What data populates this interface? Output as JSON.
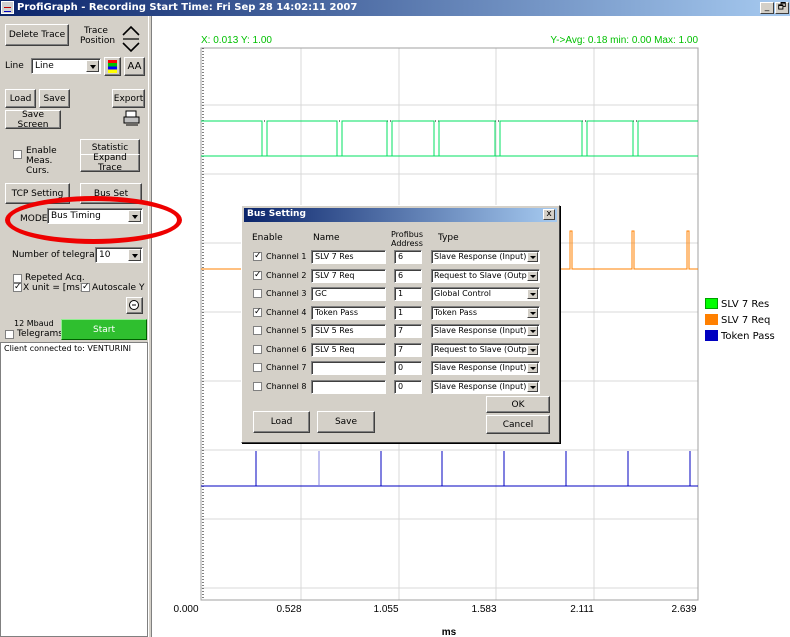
{
  "window": {
    "title": "ProfiGraph - Recording Start Time: Fri Sep 28 14:02:11 2007",
    "min_glyph": "_",
    "max_glyph": "🗗"
  },
  "left": {
    "delete_trace": "Delete Trace",
    "trace_position": "Trace Position",
    "line_label": "Line",
    "line_value": "Line",
    "font_glyph": "AA",
    "load": "Load",
    "save": "Save",
    "export": "Export",
    "save_screen": "Save Screen",
    "enable_meas": "Enable Meas. Curs.",
    "statistic": "Statistic",
    "expand_trace": "Expand Trace",
    "tcp_setting": "TCP Setting",
    "bus_set": "Bus Set",
    "mode_label": "MODE",
    "mode_value": "Bus Timing",
    "num_telegrams_label": "Number of telegrams",
    "num_telegrams_value": "10",
    "repeated_acq": "Repeted Acq.",
    "x_unit": "X unit = [ms]",
    "autoscale": "Autoscale Y",
    "baud": "12 Mbaud",
    "telegrams": "Telegrams",
    "start": "Start",
    "client_text": "Client connected to: VENTURINI"
  },
  "plot": {
    "cursor_readout": "X: 0.013   Y: 1.00",
    "stats_readout": "Y->Avg: 0.18    min: 0.00    Max: 1.00",
    "x_ticks": [
      "0.000",
      "0.528",
      "1.055",
      "1.583",
      "2.111",
      "2.639"
    ],
    "x_unit": "ms"
  },
  "legend": [
    {
      "name": "SLV 7 Res",
      "color": "#00ff00"
    },
    {
      "name": "SLV 7 Req",
      "color": "#ff8000"
    },
    {
      "name": "Token Pass",
      "color": "#0000c0"
    }
  ],
  "dialog": {
    "title": "Bus Setting",
    "close_glyph": "x",
    "col_enable": "Enable",
    "col_name": "Name",
    "col_address": "Profibus Address",
    "col_type": "Type",
    "channels": [
      {
        "label": "Channel 1",
        "checked": true,
        "name": "SLV 7 Res",
        "address": "6",
        "type": "Slave Response (Input)"
      },
      {
        "label": "Channel 2",
        "checked": true,
        "name": "SLV 7 Req",
        "address": "6",
        "type": "Request to Slave (Output)"
      },
      {
        "label": "Channel 3",
        "checked": false,
        "name": "GC",
        "address": "1",
        "type": "Global Control"
      },
      {
        "label": "Channel 4",
        "checked": true,
        "name": "Token Pass",
        "address": "1",
        "type": "Token Pass"
      },
      {
        "label": "Channel 5",
        "checked": false,
        "name": "SLV 5 Res",
        "address": "7",
        "type": "Slave Response (Input)"
      },
      {
        "label": "Channel 6",
        "checked": false,
        "name": "SLV 5 Req",
        "address": "7",
        "type": "Request to Slave (Output)"
      },
      {
        "label": "Channel 7",
        "checked": false,
        "name": "",
        "address": "0",
        "type": "Slave Response (Input)"
      },
      {
        "label": "Channel 8",
        "checked": false,
        "name": "",
        "address": "0",
        "type": "Slave Response (Input)"
      }
    ],
    "ok": "OK",
    "cancel": "Cancel",
    "load": "Load",
    "save": "Save"
  }
}
